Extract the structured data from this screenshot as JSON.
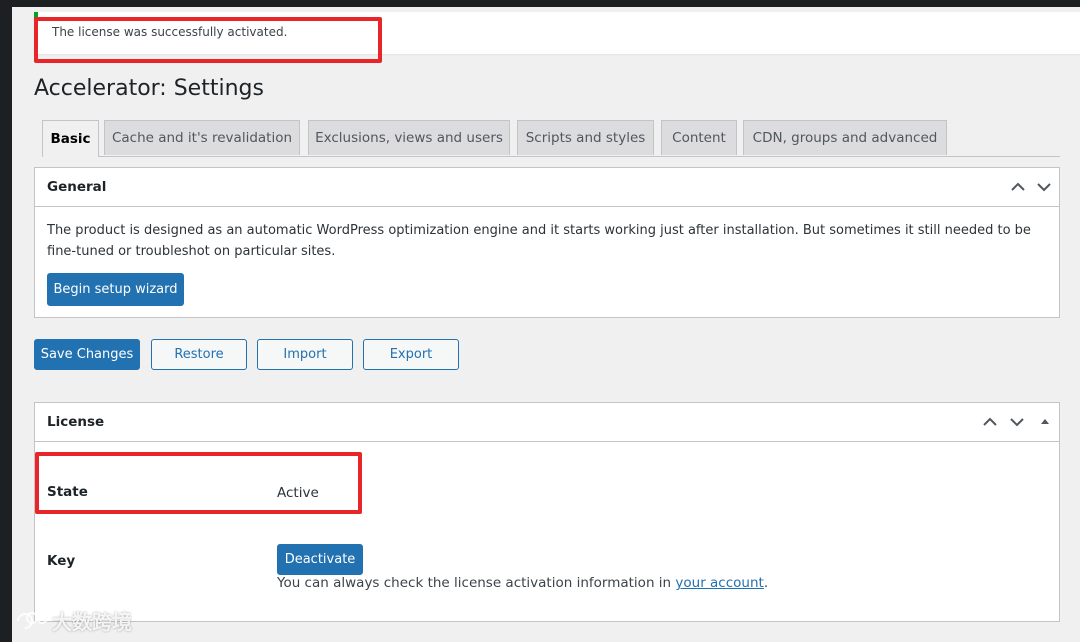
{
  "notice": {
    "message": "The license was successfully activated."
  },
  "page": {
    "title": "Accelerator: Settings"
  },
  "tabs": [
    {
      "label": "Basic",
      "active": true
    },
    {
      "label": "Cache and it's revalidation",
      "active": false
    },
    {
      "label": "Exclusions, views and users",
      "active": false
    },
    {
      "label": "Scripts and styles",
      "active": false
    },
    {
      "label": "Content",
      "active": false
    },
    {
      "label": "CDN, groups and advanced",
      "active": false
    }
  ],
  "general": {
    "title": "General",
    "description": "The product is designed as an automatic WordPress optimization engine and it starts working just after installation. But sometimes it still needed to be fine-tuned or troubleshot on particular sites.",
    "wizard_button": "Begin setup wizard"
  },
  "actions": {
    "save": "Save Changes",
    "restore": "Restore",
    "import": "Import",
    "export": "Export"
  },
  "license": {
    "title": "License",
    "state_label": "State",
    "state_value": "Active",
    "key_label": "Key",
    "deactivate_button": "Deactivate",
    "note_prefix": "You can always check the license activation information in ",
    "note_link": "your account",
    "note_suffix": "."
  },
  "watermark": {
    "text": "大数跨境"
  },
  "colors": {
    "primary": "#2271b1",
    "success": "#00a32a",
    "highlight": "#e8262a",
    "background": "#f0f0f1"
  }
}
